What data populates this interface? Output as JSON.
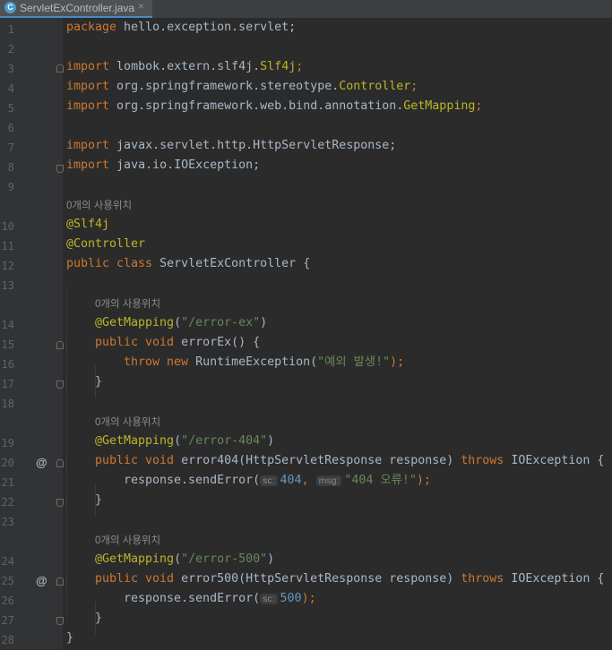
{
  "tab": {
    "icon_letter": "C",
    "label": "ServletExController.java",
    "close": "×"
  },
  "hint_text": "0개의 사용위치",
  "code": {
    "l1": {
      "kw": "package",
      "rest": " hello.exception.servlet;"
    },
    "l3": {
      "kw": "import",
      "pkg": " lombok.extern.slf4j.",
      "cls": "Slf4j",
      "end": ";"
    },
    "l4": {
      "kw": "import",
      "pkg": " org.springframework.stereotype.",
      "cls": "Controller",
      "end": ";"
    },
    "l5": {
      "kw": "import",
      "pkg": " org.springframework.web.bind.annotation.",
      "cls": "GetMapping",
      "end": ";"
    },
    "l7": {
      "kw": "import",
      "rest": " javax.servlet.http.HttpServletResponse;"
    },
    "l8": {
      "kw": "import",
      "rest": " java.io.IOException;"
    },
    "l10": {
      "ann": "@Slf4j"
    },
    "l11": {
      "ann": "@Controller"
    },
    "l12": {
      "kw": "public class",
      "rest": " ServletExController {"
    },
    "l14": {
      "ann": "@GetMapping",
      "open": "(",
      "str": "\"/error-ex\"",
      "close": ")"
    },
    "l15": {
      "kw": "public void",
      "rest": " errorEx() {"
    },
    "l16": {
      "kw": "throw new",
      "rest": " RuntimeException(",
      "str": "\"예외 발생!\"",
      "end": ");"
    },
    "l17": {
      "rest": "}"
    },
    "l19": {
      "ann": "@GetMapping",
      "open": "(",
      "str": "\"/error-404\"",
      "close": ")"
    },
    "l20": {
      "kw": "public void",
      "rest": " error404(HttpServletResponse response) ",
      "kw2": "throws",
      "rest2": " IOException {"
    },
    "l21": {
      "rest": "response.sendError(",
      "hint1": "sc:",
      "num": "404",
      "sep": ", ",
      "hint2": "msg:",
      "str": "\"404 오류!\"",
      "end": ");"
    },
    "l22": {
      "rest": "}"
    },
    "l24": {
      "ann": "@GetMapping",
      "open": "(",
      "str": "\"/error-500\"",
      "close": ")"
    },
    "l25": {
      "kw": "public void",
      "rest": " error500(HttpServletResponse response) ",
      "kw2": "throws",
      "rest2": " IOException {"
    },
    "l26": {
      "rest": "response.sendError(",
      "hint1": "sc:",
      "num": "500",
      "end": ");"
    },
    "l27": {
      "rest": "}"
    },
    "l28": {
      "rest": "}"
    }
  },
  "line_numbers": [
    "1",
    "2",
    "3",
    "4",
    "5",
    "6",
    "7",
    "8",
    "9",
    "10",
    "11",
    "12",
    "13",
    "14",
    "15",
    "16",
    "17",
    "18",
    "19",
    "20",
    "21",
    "22",
    "23",
    "24",
    "25",
    "26",
    "27",
    "28"
  ],
  "gutter_marker": "@",
  "colors": {
    "background": "#2b2b2b",
    "gutter": "#313335",
    "keyword": "#cc7832",
    "annotation": "#bbb529",
    "string": "#6a8759",
    "number": "#6897bb",
    "text": "#a9b7c6"
  }
}
